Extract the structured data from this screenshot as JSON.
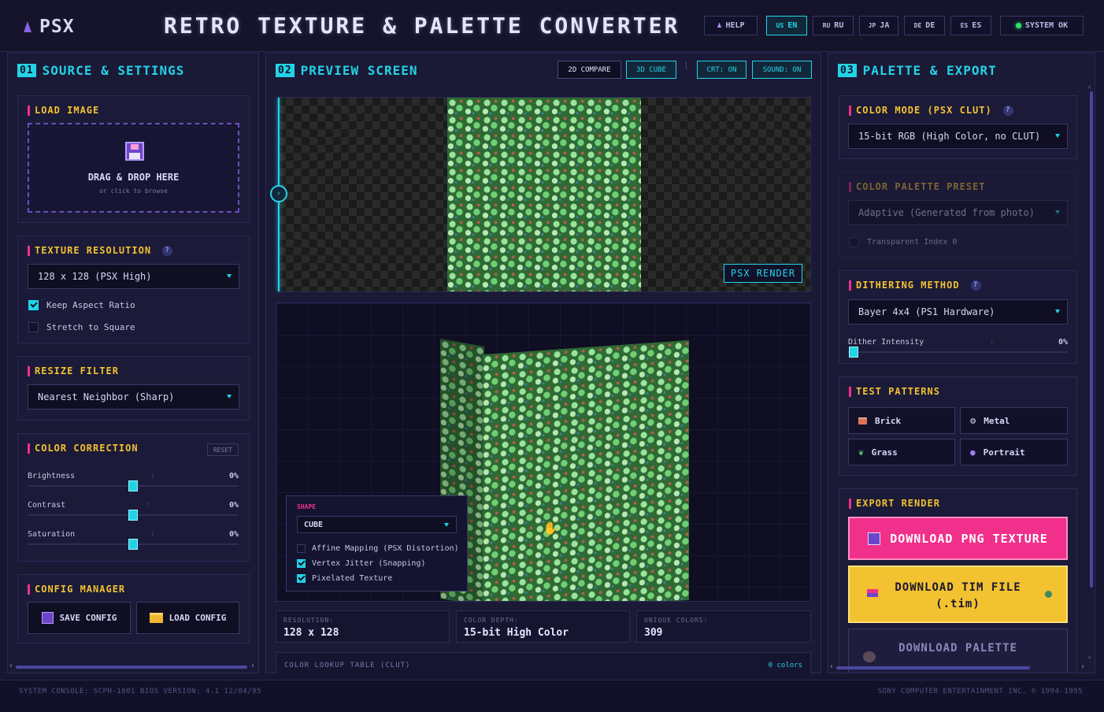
{
  "header": {
    "logo": "PSX",
    "title": "RETRO TEXTURE & PALETTE CONVERTER",
    "help": "HELP",
    "languages": [
      {
        "flag": "US",
        "label": "EN"
      },
      {
        "flag": "RU",
        "label": "RU"
      },
      {
        "flag": "JP",
        "label": "JA"
      },
      {
        "flag": "DE",
        "label": "DE"
      },
      {
        "flag": "ES",
        "label": "ES"
      }
    ],
    "active_language": "EN",
    "system_status": "SYSTEM OK"
  },
  "left": {
    "num": "01",
    "title": "SOURCE & SETTINGS",
    "load_image": {
      "title": "LOAD IMAGE",
      "drop_text": "DRAG & DROP HERE",
      "browse_text": "or click to browse"
    },
    "texture_resolution": {
      "title": "TEXTURE RESOLUTION",
      "value": "128 x 128 (PSX High)",
      "keep_aspect": "Keep Aspect Ratio",
      "keep_aspect_checked": true,
      "stretch": "Stretch to Square",
      "stretch_checked": false
    },
    "resize_filter": {
      "title": "RESIZE FILTER",
      "value": "Nearest Neighbor (Sharp)"
    },
    "color_correction": {
      "title": "COLOR CORRECTION",
      "reset": "RESET",
      "sliders": [
        {
          "label": "Brightness",
          "value": "0%",
          "level": 0.5
        },
        {
          "label": "Contrast",
          "value": "0%",
          "level": 0.5
        },
        {
          "label": "Saturation",
          "value": "0%",
          "level": 0.5
        }
      ]
    },
    "config_manager": {
      "title": "CONFIG MANAGER",
      "save": "SAVE CONFIG",
      "load": "LOAD CONFIG"
    }
  },
  "center": {
    "num": "02",
    "title": "PREVIEW SCREEN",
    "mode_2d": "2D COMPARE",
    "mode_3d": "3D CUBE",
    "crt": "CRT: ON",
    "sound": "SOUND: ON",
    "psx_render": "PSX RENDER",
    "shape_panel": {
      "label": "SHAPE",
      "value": "CUBE",
      "options": [
        {
          "label": "Affine Mapping (PSX Distortion)",
          "checked": false
        },
        {
          "label": "Vertex Jitter (Snapping)",
          "checked": true
        },
        {
          "label": "Pixelated Texture",
          "checked": true
        }
      ]
    },
    "info": [
      {
        "label": "RESOLUTION:",
        "value": "128 x 128"
      },
      {
        "label": "COLOR DEPTH:",
        "value": "15-bit High Color"
      },
      {
        "label": "UNIQUE COLORS:",
        "value": "309"
      }
    ],
    "clut": {
      "title": "COLOR LOOKUP TABLE (CLUT)",
      "count": "0 colors"
    }
  },
  "right": {
    "num": "03",
    "title": "PALETTE & EXPORT",
    "color_mode": {
      "title": "COLOR MODE (PSX CLUT)",
      "value": "15-bit RGB (High Color, no CLUT)"
    },
    "palette_preset": {
      "title": "COLOR PALETTE PRESET",
      "value": "Adaptive (Generated from photo)",
      "transparent": "Transparent Index 0"
    },
    "dithering": {
      "title": "DITHERING METHOD",
      "value": "Bayer 4x4 (PS1 Hardware)",
      "intensity_label": "Dither Intensity",
      "intensity_value": "0%",
      "level": 0
    },
    "test_patterns": {
      "title": "TEST PATTERNS",
      "items": [
        "Brick",
        "Metal",
        "Grass",
        "Portrait"
      ]
    },
    "export": {
      "title": "EXPORT RENDER",
      "png": "DOWNLOAD PNG TEXTURE",
      "tim_line1": "DOWNLOAD TIM FILE",
      "tim_line2": "(.tim)",
      "palette": "DOWNLOAD PALETTE"
    }
  },
  "footer": {
    "console": "SYSTEM CONSOLE: SCPH-1001",
    "bios": "BIOS VERSION: 4.1 12/04/95",
    "copyright": "SONY COMPUTER ENTERTAINMENT INC. © 1994-1995"
  },
  "colors": {
    "accent": "#22d3e6",
    "yellow": "#f2c230",
    "pink": "#f0308a",
    "bg": "#171630"
  }
}
